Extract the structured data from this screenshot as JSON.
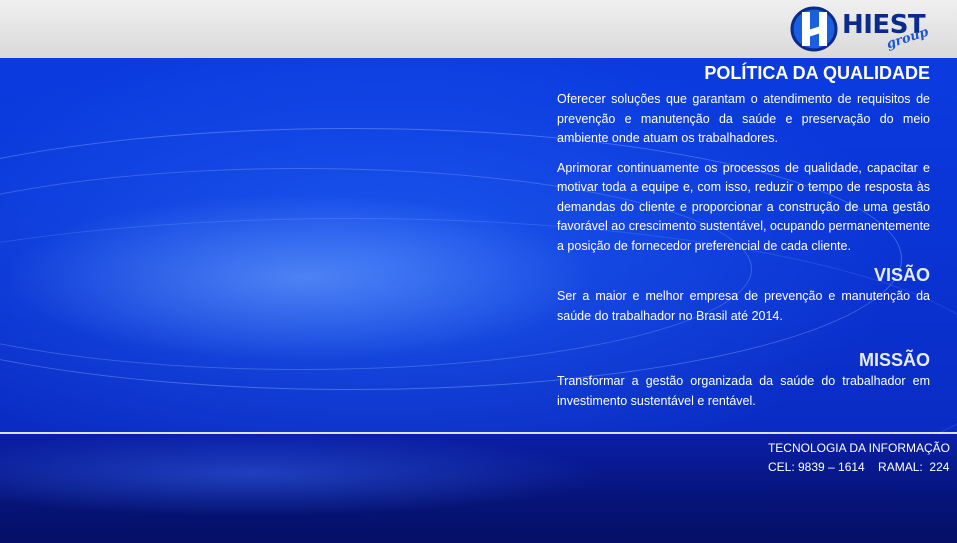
{
  "header": {
    "logo": {
      "name": "HIEST",
      "subtitle": "group"
    }
  },
  "sections": {
    "politica": {
      "title": "POLÍTICA DA QUALIDADE",
      "paragraphs": [
        "Oferecer soluções que garantam o atendimento de requisitos de prevenção e manutenção da saúde e preservação do meio ambiente onde atuam os trabalhadores.",
        "Aprimorar continuamente os processos de qualidade, capacitar e motivar toda a equipe e, com isso, reduzir o tempo de resposta às demandas do cliente e proporcionar a construção de uma gestão favorável ao crescimento sustentável, ocupando permanentemente a posição de fornecedor preferencial de cada cliente."
      ]
    },
    "visao": {
      "title": "VISÃO",
      "text": "Ser a maior e melhor empresa de prevenção e manutenção da saúde do trabalhador no Brasil até 2014."
    },
    "missao": {
      "title": "MISSÃO",
      "text": "Transformar a gestão organizada da saúde do trabalhador em investimento sustentável e rentável."
    }
  },
  "footer": {
    "line1": "TECNOLOGIA DA INFORMAÇÃO",
    "line2": "CEL: 9839 – 1614    RAMAL:  224"
  },
  "colors": {
    "background_blue": "#0a35d6",
    "footer_blue": "#061479",
    "topbar_gray": "#e4e4e4",
    "logo_navy": "#0a2a8c"
  }
}
